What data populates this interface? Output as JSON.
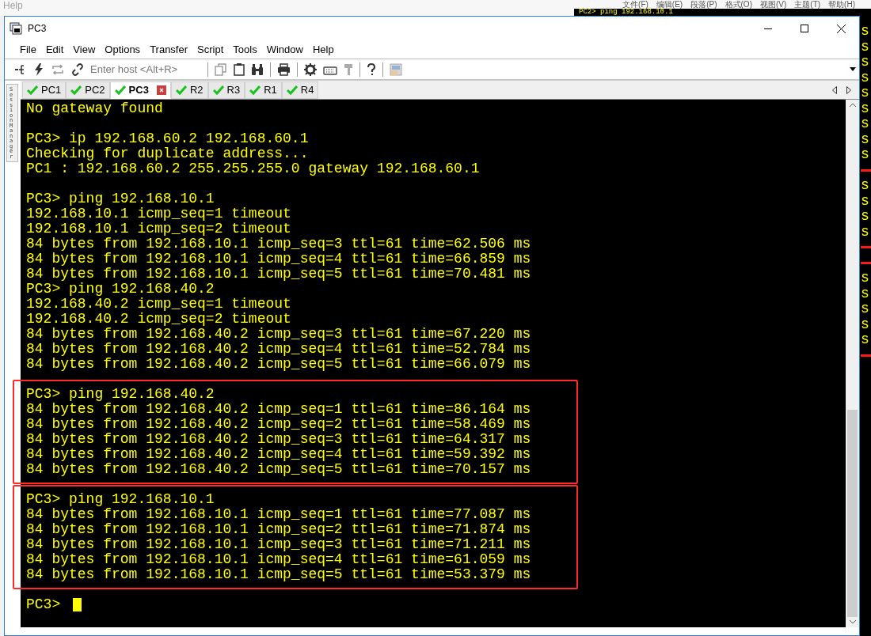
{
  "background": {
    "menu_left": "Help",
    "menu_right": [
      "文件(F)",
      "编辑(E)",
      "段落(P)",
      "格式(O)",
      "视图(V)",
      "主题(T)",
      "帮助(H)"
    ],
    "terminal_title_line": "PC2> ping 192.168.10.1",
    "terminal_rows": [
      {
        "kind": "text",
        "text": "s"
      },
      {
        "kind": "text",
        "text": "s"
      },
      {
        "kind": "text",
        "text": "s"
      },
      {
        "kind": "text",
        "text": "s"
      },
      {
        "kind": "text",
        "text": "s"
      },
      {
        "kind": "text",
        "text": "s"
      },
      {
        "kind": "text",
        "text": "s"
      },
      {
        "kind": "text",
        "text": "s"
      },
      {
        "kind": "text",
        "text": "s"
      },
      {
        "kind": "rule"
      },
      {
        "kind": "text",
        "text": "s"
      },
      {
        "kind": "text",
        "text": "s"
      },
      {
        "kind": "text",
        "text": "s"
      },
      {
        "kind": "text",
        "text": "s"
      },
      {
        "kind": "rule"
      },
      {
        "kind": "rule"
      },
      {
        "kind": "text",
        "text": "s"
      },
      {
        "kind": "text",
        "text": "s"
      },
      {
        "kind": "text",
        "text": "s"
      },
      {
        "kind": "text",
        "text": "s"
      },
      {
        "kind": "text",
        "text": "s"
      },
      {
        "kind": "rule"
      }
    ]
  },
  "window": {
    "title": "PC3"
  },
  "menu": [
    "File",
    "Edit",
    "View",
    "Options",
    "Transfer",
    "Script",
    "Tools",
    "Window",
    "Help"
  ],
  "toolbar": {
    "host_placeholder": "Enter host <Alt+R>"
  },
  "sidebar": {
    "label": "Session Manager"
  },
  "tabs": [
    {
      "label": "PC1",
      "selected": false
    },
    {
      "label": "PC2",
      "selected": false
    },
    {
      "label": "PC3",
      "selected": true
    },
    {
      "label": "R2",
      "selected": false
    },
    {
      "label": "R3",
      "selected": false
    },
    {
      "label": "R1",
      "selected": false
    },
    {
      "label": "R4",
      "selected": false
    }
  ],
  "terminal": {
    "blocks": [
      {
        "highlighted": false,
        "lines": [
          "No gateway found"
        ]
      },
      {
        "highlighted": false,
        "lines": [
          "PC3> ip 192.168.60.2 192.168.60.1",
          "Checking for duplicate address...",
          "PC1 : 192.168.60.2 255.255.255.0 gateway 192.168.60.1"
        ]
      },
      {
        "highlighted": false,
        "lines": [
          "PC3> ping 192.168.10.1",
          "192.168.10.1 icmp_seq=1 timeout",
          "192.168.10.1 icmp_seq=2 timeout",
          "84 bytes from 192.168.10.1 icmp_seq=3 ttl=61 time=62.506 ms",
          "84 bytes from 192.168.10.1 icmp_seq=4 ttl=61 time=66.859 ms",
          "84 bytes from 192.168.10.1 icmp_seq=5 ttl=61 time=70.481 ms",
          "PC3> ping 192.168.40.2",
          "192.168.40.2 icmp_seq=1 timeout",
          "192.168.40.2 icmp_seq=2 timeout",
          "84 bytes from 192.168.40.2 icmp_seq=3 ttl=61 time=67.220 ms",
          "84 bytes from 192.168.40.2 icmp_seq=4 ttl=61 time=52.784 ms",
          "84 bytes from 192.168.40.2 icmp_seq=5 ttl=61 time=66.079 ms"
        ]
      },
      {
        "highlighted": true,
        "lines": [
          "PC3> ping 192.168.40.2",
          "84 bytes from 192.168.40.2 icmp_seq=1 ttl=61 time=86.164 ms",
          "84 bytes from 192.168.40.2 icmp_seq=2 ttl=61 time=58.469 ms",
          "84 bytes from 192.168.40.2 icmp_seq=3 ttl=61 time=64.317 ms",
          "84 bytes from 192.168.40.2 icmp_seq=4 ttl=61 time=59.392 ms",
          "84 bytes from 192.168.40.2 icmp_seq=5 ttl=61 time=70.157 ms"
        ]
      },
      {
        "highlighted": true,
        "lines": [
          "PC3> ping 192.168.10.1",
          "84 bytes from 192.168.10.1 icmp_seq=1 ttl=61 time=77.087 ms",
          "84 bytes from 192.168.10.1 icmp_seq=2 ttl=61 time=71.874 ms",
          "84 bytes from 192.168.10.1 icmp_seq=3 ttl=61 time=71.211 ms",
          "84 bytes from 192.168.10.1 icmp_seq=4 ttl=61 time=61.059 ms",
          "84 bytes from 192.168.10.1 icmp_seq=5 ttl=61 time=53.379 ms"
        ]
      }
    ],
    "prompt": "PC3>",
    "cursor": true
  }
}
